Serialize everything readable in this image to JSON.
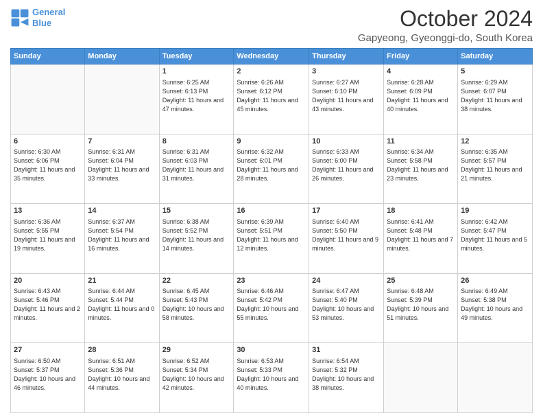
{
  "header": {
    "logo_line1": "General",
    "logo_line2": "Blue",
    "title": "October 2024",
    "subtitle": "Gapyeong, Gyeonggi-do, South Korea"
  },
  "days_of_week": [
    "Sunday",
    "Monday",
    "Tuesday",
    "Wednesday",
    "Thursday",
    "Friday",
    "Saturday"
  ],
  "weeks": [
    [
      {
        "day": "",
        "empty": true
      },
      {
        "day": "",
        "empty": true
      },
      {
        "day": "1",
        "sunrise": "6:25 AM",
        "sunset": "6:13 PM",
        "daylight": "11 hours and 47 minutes."
      },
      {
        "day": "2",
        "sunrise": "6:26 AM",
        "sunset": "6:12 PM",
        "daylight": "11 hours and 45 minutes."
      },
      {
        "day": "3",
        "sunrise": "6:27 AM",
        "sunset": "6:10 PM",
        "daylight": "11 hours and 43 minutes."
      },
      {
        "day": "4",
        "sunrise": "6:28 AM",
        "sunset": "6:09 PM",
        "daylight": "11 hours and 40 minutes."
      },
      {
        "day": "5",
        "sunrise": "6:29 AM",
        "sunset": "6:07 PM",
        "daylight": "11 hours and 38 minutes."
      }
    ],
    [
      {
        "day": "6",
        "sunrise": "6:30 AM",
        "sunset": "6:06 PM",
        "daylight": "11 hours and 35 minutes."
      },
      {
        "day": "7",
        "sunrise": "6:31 AM",
        "sunset": "6:04 PM",
        "daylight": "11 hours and 33 minutes."
      },
      {
        "day": "8",
        "sunrise": "6:31 AM",
        "sunset": "6:03 PM",
        "daylight": "11 hours and 31 minutes."
      },
      {
        "day": "9",
        "sunrise": "6:32 AM",
        "sunset": "6:01 PM",
        "daylight": "11 hours and 28 minutes."
      },
      {
        "day": "10",
        "sunrise": "6:33 AM",
        "sunset": "6:00 PM",
        "daylight": "11 hours and 26 minutes."
      },
      {
        "day": "11",
        "sunrise": "6:34 AM",
        "sunset": "5:58 PM",
        "daylight": "11 hours and 23 minutes."
      },
      {
        "day": "12",
        "sunrise": "6:35 AM",
        "sunset": "5:57 PM",
        "daylight": "11 hours and 21 minutes."
      }
    ],
    [
      {
        "day": "13",
        "sunrise": "6:36 AM",
        "sunset": "5:55 PM",
        "daylight": "11 hours and 19 minutes."
      },
      {
        "day": "14",
        "sunrise": "6:37 AM",
        "sunset": "5:54 PM",
        "daylight": "11 hours and 16 minutes."
      },
      {
        "day": "15",
        "sunrise": "6:38 AM",
        "sunset": "5:52 PM",
        "daylight": "11 hours and 14 minutes."
      },
      {
        "day": "16",
        "sunrise": "6:39 AM",
        "sunset": "5:51 PM",
        "daylight": "11 hours and 12 minutes."
      },
      {
        "day": "17",
        "sunrise": "6:40 AM",
        "sunset": "5:50 PM",
        "daylight": "11 hours and 9 minutes."
      },
      {
        "day": "18",
        "sunrise": "6:41 AM",
        "sunset": "5:48 PM",
        "daylight": "11 hours and 7 minutes."
      },
      {
        "day": "19",
        "sunrise": "6:42 AM",
        "sunset": "5:47 PM",
        "daylight": "11 hours and 5 minutes."
      }
    ],
    [
      {
        "day": "20",
        "sunrise": "6:43 AM",
        "sunset": "5:46 PM",
        "daylight": "11 hours and 2 minutes."
      },
      {
        "day": "21",
        "sunrise": "6:44 AM",
        "sunset": "5:44 PM",
        "daylight": "11 hours and 0 minutes."
      },
      {
        "day": "22",
        "sunrise": "6:45 AM",
        "sunset": "5:43 PM",
        "daylight": "10 hours and 58 minutes."
      },
      {
        "day": "23",
        "sunrise": "6:46 AM",
        "sunset": "5:42 PM",
        "daylight": "10 hours and 55 minutes."
      },
      {
        "day": "24",
        "sunrise": "6:47 AM",
        "sunset": "5:40 PM",
        "daylight": "10 hours and 53 minutes."
      },
      {
        "day": "25",
        "sunrise": "6:48 AM",
        "sunset": "5:39 PM",
        "daylight": "10 hours and 51 minutes."
      },
      {
        "day": "26",
        "sunrise": "6:49 AM",
        "sunset": "5:38 PM",
        "daylight": "10 hours and 49 minutes."
      }
    ],
    [
      {
        "day": "27",
        "sunrise": "6:50 AM",
        "sunset": "5:37 PM",
        "daylight": "10 hours and 46 minutes."
      },
      {
        "day": "28",
        "sunrise": "6:51 AM",
        "sunset": "5:36 PM",
        "daylight": "10 hours and 44 minutes."
      },
      {
        "day": "29",
        "sunrise": "6:52 AM",
        "sunset": "5:34 PM",
        "daylight": "10 hours and 42 minutes."
      },
      {
        "day": "30",
        "sunrise": "6:53 AM",
        "sunset": "5:33 PM",
        "daylight": "10 hours and 40 minutes."
      },
      {
        "day": "31",
        "sunrise": "6:54 AM",
        "sunset": "5:32 PM",
        "daylight": "10 hours and 38 minutes."
      },
      {
        "day": "",
        "empty": true
      },
      {
        "day": "",
        "empty": true
      }
    ]
  ],
  "labels": {
    "sunrise": "Sunrise:",
    "sunset": "Sunset:",
    "daylight": "Daylight:"
  }
}
